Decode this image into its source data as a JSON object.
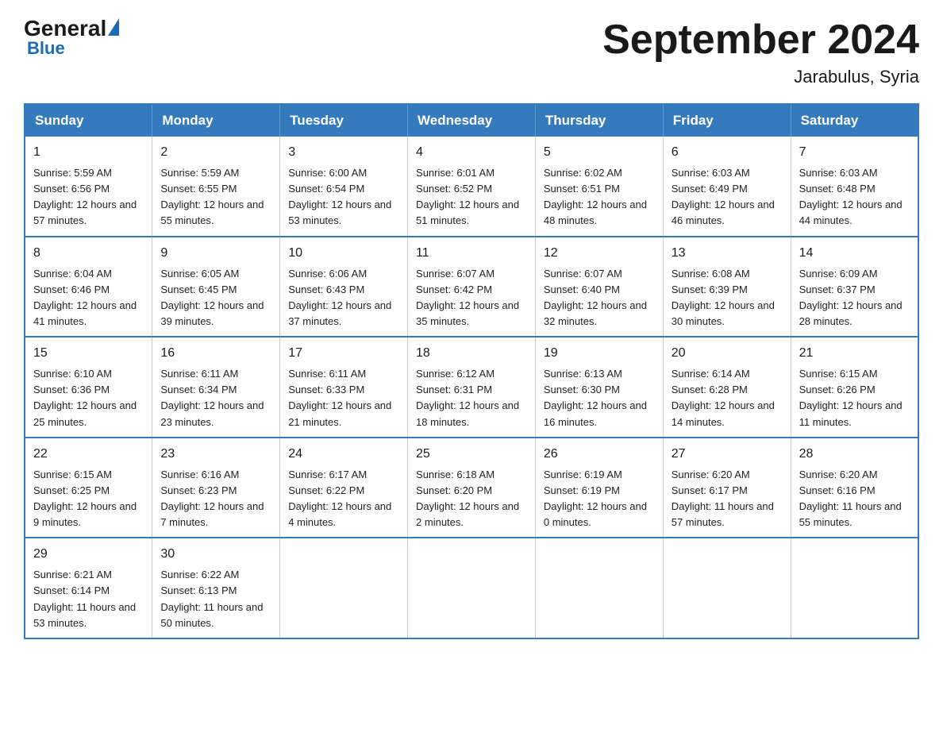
{
  "header": {
    "logo_general": "General",
    "logo_blue": "Blue",
    "month_title": "September 2024",
    "location": "Jarabulus, Syria"
  },
  "days_of_week": [
    "Sunday",
    "Monday",
    "Tuesday",
    "Wednesday",
    "Thursday",
    "Friday",
    "Saturday"
  ],
  "weeks": [
    [
      {
        "day": "1",
        "sunrise": "Sunrise: 5:59 AM",
        "sunset": "Sunset: 6:56 PM",
        "daylight": "Daylight: 12 hours and 57 minutes."
      },
      {
        "day": "2",
        "sunrise": "Sunrise: 5:59 AM",
        "sunset": "Sunset: 6:55 PM",
        "daylight": "Daylight: 12 hours and 55 minutes."
      },
      {
        "day": "3",
        "sunrise": "Sunrise: 6:00 AM",
        "sunset": "Sunset: 6:54 PM",
        "daylight": "Daylight: 12 hours and 53 minutes."
      },
      {
        "day": "4",
        "sunrise": "Sunrise: 6:01 AM",
        "sunset": "Sunset: 6:52 PM",
        "daylight": "Daylight: 12 hours and 51 minutes."
      },
      {
        "day": "5",
        "sunrise": "Sunrise: 6:02 AM",
        "sunset": "Sunset: 6:51 PM",
        "daylight": "Daylight: 12 hours and 48 minutes."
      },
      {
        "day": "6",
        "sunrise": "Sunrise: 6:03 AM",
        "sunset": "Sunset: 6:49 PM",
        "daylight": "Daylight: 12 hours and 46 minutes."
      },
      {
        "day": "7",
        "sunrise": "Sunrise: 6:03 AM",
        "sunset": "Sunset: 6:48 PM",
        "daylight": "Daylight: 12 hours and 44 minutes."
      }
    ],
    [
      {
        "day": "8",
        "sunrise": "Sunrise: 6:04 AM",
        "sunset": "Sunset: 6:46 PM",
        "daylight": "Daylight: 12 hours and 41 minutes."
      },
      {
        "day": "9",
        "sunrise": "Sunrise: 6:05 AM",
        "sunset": "Sunset: 6:45 PM",
        "daylight": "Daylight: 12 hours and 39 minutes."
      },
      {
        "day": "10",
        "sunrise": "Sunrise: 6:06 AM",
        "sunset": "Sunset: 6:43 PM",
        "daylight": "Daylight: 12 hours and 37 minutes."
      },
      {
        "day": "11",
        "sunrise": "Sunrise: 6:07 AM",
        "sunset": "Sunset: 6:42 PM",
        "daylight": "Daylight: 12 hours and 35 minutes."
      },
      {
        "day": "12",
        "sunrise": "Sunrise: 6:07 AM",
        "sunset": "Sunset: 6:40 PM",
        "daylight": "Daylight: 12 hours and 32 minutes."
      },
      {
        "day": "13",
        "sunrise": "Sunrise: 6:08 AM",
        "sunset": "Sunset: 6:39 PM",
        "daylight": "Daylight: 12 hours and 30 minutes."
      },
      {
        "day": "14",
        "sunrise": "Sunrise: 6:09 AM",
        "sunset": "Sunset: 6:37 PM",
        "daylight": "Daylight: 12 hours and 28 minutes."
      }
    ],
    [
      {
        "day": "15",
        "sunrise": "Sunrise: 6:10 AM",
        "sunset": "Sunset: 6:36 PM",
        "daylight": "Daylight: 12 hours and 25 minutes."
      },
      {
        "day": "16",
        "sunrise": "Sunrise: 6:11 AM",
        "sunset": "Sunset: 6:34 PM",
        "daylight": "Daylight: 12 hours and 23 minutes."
      },
      {
        "day": "17",
        "sunrise": "Sunrise: 6:11 AM",
        "sunset": "Sunset: 6:33 PM",
        "daylight": "Daylight: 12 hours and 21 minutes."
      },
      {
        "day": "18",
        "sunrise": "Sunrise: 6:12 AM",
        "sunset": "Sunset: 6:31 PM",
        "daylight": "Daylight: 12 hours and 18 minutes."
      },
      {
        "day": "19",
        "sunrise": "Sunrise: 6:13 AM",
        "sunset": "Sunset: 6:30 PM",
        "daylight": "Daylight: 12 hours and 16 minutes."
      },
      {
        "day": "20",
        "sunrise": "Sunrise: 6:14 AM",
        "sunset": "Sunset: 6:28 PM",
        "daylight": "Daylight: 12 hours and 14 minutes."
      },
      {
        "day": "21",
        "sunrise": "Sunrise: 6:15 AM",
        "sunset": "Sunset: 6:26 PM",
        "daylight": "Daylight: 12 hours and 11 minutes."
      }
    ],
    [
      {
        "day": "22",
        "sunrise": "Sunrise: 6:15 AM",
        "sunset": "Sunset: 6:25 PM",
        "daylight": "Daylight: 12 hours and 9 minutes."
      },
      {
        "day": "23",
        "sunrise": "Sunrise: 6:16 AM",
        "sunset": "Sunset: 6:23 PM",
        "daylight": "Daylight: 12 hours and 7 minutes."
      },
      {
        "day": "24",
        "sunrise": "Sunrise: 6:17 AM",
        "sunset": "Sunset: 6:22 PM",
        "daylight": "Daylight: 12 hours and 4 minutes."
      },
      {
        "day": "25",
        "sunrise": "Sunrise: 6:18 AM",
        "sunset": "Sunset: 6:20 PM",
        "daylight": "Daylight: 12 hours and 2 minutes."
      },
      {
        "day": "26",
        "sunrise": "Sunrise: 6:19 AM",
        "sunset": "Sunset: 6:19 PM",
        "daylight": "Daylight: 12 hours and 0 minutes."
      },
      {
        "day": "27",
        "sunrise": "Sunrise: 6:20 AM",
        "sunset": "Sunset: 6:17 PM",
        "daylight": "Daylight: 11 hours and 57 minutes."
      },
      {
        "day": "28",
        "sunrise": "Sunrise: 6:20 AM",
        "sunset": "Sunset: 6:16 PM",
        "daylight": "Daylight: 11 hours and 55 minutes."
      }
    ],
    [
      {
        "day": "29",
        "sunrise": "Sunrise: 6:21 AM",
        "sunset": "Sunset: 6:14 PM",
        "daylight": "Daylight: 11 hours and 53 minutes."
      },
      {
        "day": "30",
        "sunrise": "Sunrise: 6:22 AM",
        "sunset": "Sunset: 6:13 PM",
        "daylight": "Daylight: 11 hours and 50 minutes."
      },
      null,
      null,
      null,
      null,
      null
    ]
  ]
}
